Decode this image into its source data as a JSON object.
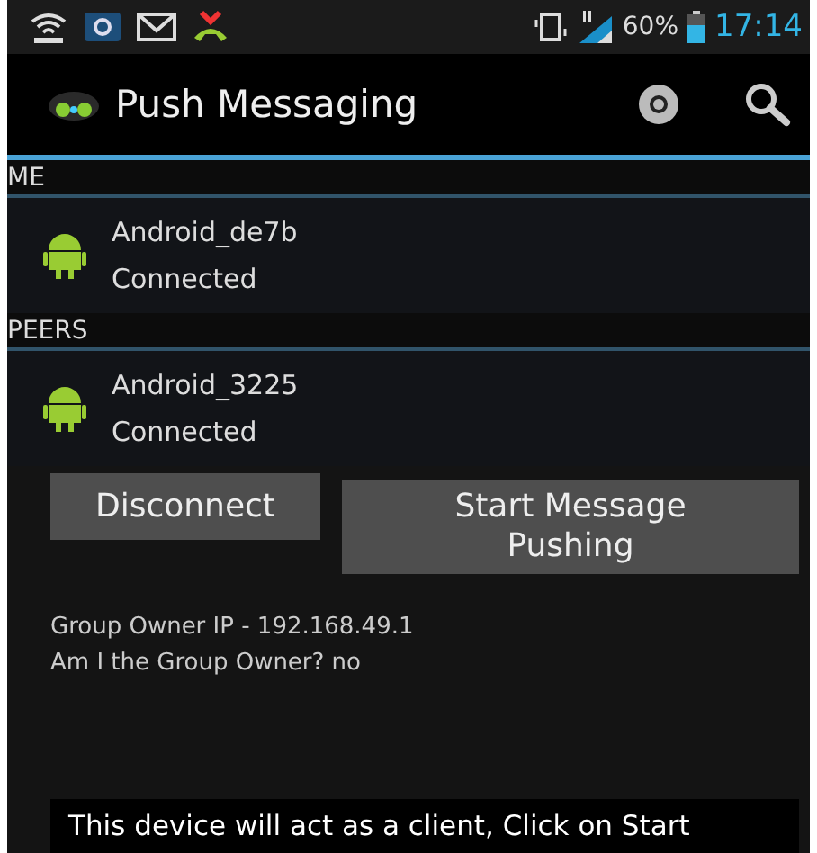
{
  "status_bar": {
    "battery": "60%",
    "time": "17:14"
  },
  "action_bar": {
    "title": "Push Messaging"
  },
  "sections": [
    {
      "header": "ME",
      "devices": [
        {
          "name": "Android_de7b",
          "status": "Connected"
        }
      ]
    },
    {
      "header": "PEERS",
      "devices": [
        {
          "name": "Android_3225",
          "status": "Connected"
        }
      ]
    }
  ],
  "buttons": [
    {
      "label": "Disconnect"
    },
    {
      "label": "Start Message Pushing"
    }
  ],
  "info": [
    "Group Owner IP - 192.168.49.1",
    "Am I the Group Owner? no"
  ],
  "toast": "This device will act as a client, Click on Start"
}
